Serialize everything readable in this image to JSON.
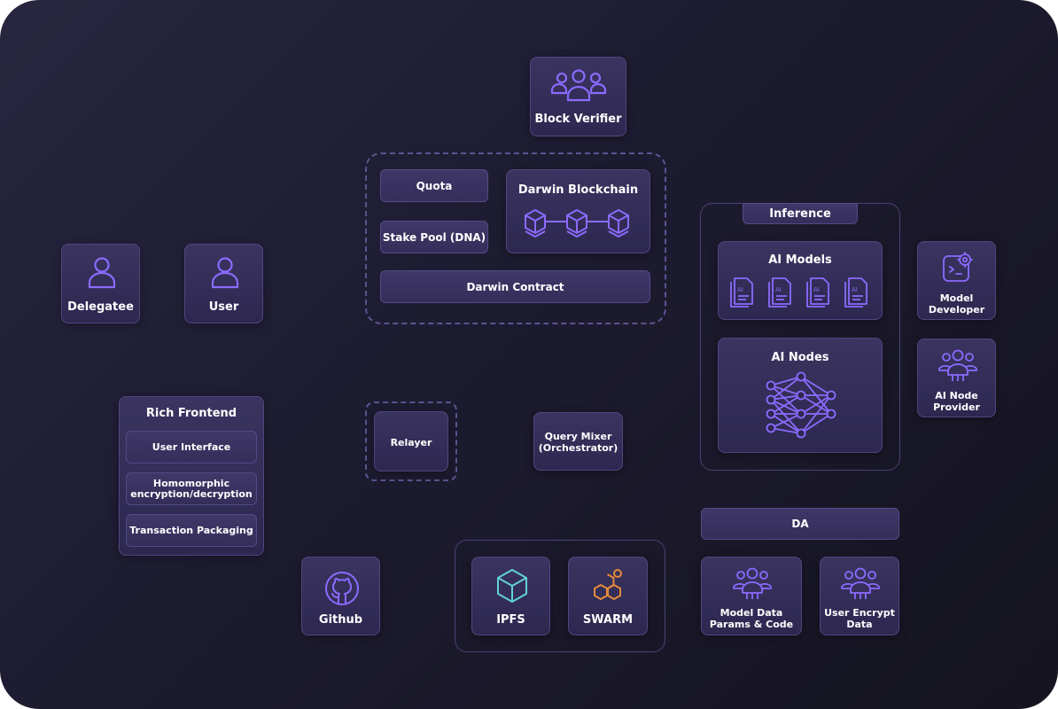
{
  "colors": {
    "background": "#1e1c30",
    "card": "#352f5a",
    "card_border": "#4f4680",
    "icon_purple": "#8b6bff",
    "ipfs_teal": "#62d1d9",
    "swarm_orange": "#e7893a"
  },
  "top": {
    "block_verifier": "Block Verifier"
  },
  "contract_group": {
    "quota": "Quota",
    "stake_pool": "Stake Pool (DNA)",
    "blockchain": "Darwin Blockchain",
    "contract": "Darwin Contract"
  },
  "actors": {
    "delegatee": "Delegatee",
    "user": "User"
  },
  "frontend": {
    "title": "Rich Frontend",
    "items": [
      "User Interface",
      "Homomorphic\nencryption/decryption",
      "Transaction Packaging"
    ]
  },
  "middle": {
    "relayer": "Relayer",
    "query_mixer_1": "Query Mixer",
    "query_mixer_2": "(Orchestrator)"
  },
  "inference": {
    "title": "Inference",
    "models_title": "AI Models",
    "doc_label": "AI",
    "nodes_title": "AI Nodes"
  },
  "side": {
    "model_dev_1": "Model",
    "model_dev_2": "Developer",
    "node_provider_1": "AI Node",
    "node_provider_2": "Provider"
  },
  "da": {
    "title": "DA",
    "model_data_1": "Model Data",
    "model_data_2": "Params & Code",
    "user_data_1": "User Encrypt",
    "user_data_2": "Data"
  },
  "storage": {
    "github": "Github",
    "ipfs": "IPFS",
    "swarm": "SWARM"
  }
}
